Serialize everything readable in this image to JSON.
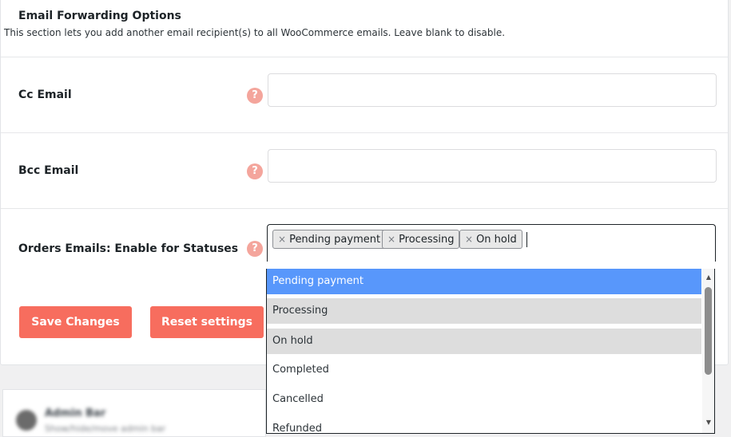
{
  "section": {
    "title": "Email Forwarding Options",
    "description": "This section lets you add another email recipient(s) to all WooCommerce emails. Leave blank to disable."
  },
  "fields": {
    "cc": {
      "label": "Cc Email",
      "value": "",
      "help_icon": "question-icon"
    },
    "bcc": {
      "label": "Bcc Email",
      "value": "",
      "help_icon": "question-icon"
    },
    "statuses": {
      "label": "Orders Emails: Enable for Statuses",
      "help_icon": "question-icon",
      "chip_remove": "×",
      "selected": [
        "Pending payment",
        "Processing",
        "On hold"
      ],
      "options": [
        "Pending payment",
        "Processing",
        "On hold",
        "Completed",
        "Cancelled",
        "Refunded"
      ],
      "highlighted": "Pending payment"
    }
  },
  "help_glyph": "?",
  "buttons": {
    "save": "Save Changes",
    "reset": "Reset settings"
  },
  "blurred_card": {
    "title": "Admin Bar",
    "subtitle": "Show/hide/move admin bar"
  },
  "colors": {
    "accent": "#f76d5e",
    "help_icon": "#f4a59c",
    "highlight": "#5897fb",
    "selected_option_bg": "#dddddd"
  }
}
